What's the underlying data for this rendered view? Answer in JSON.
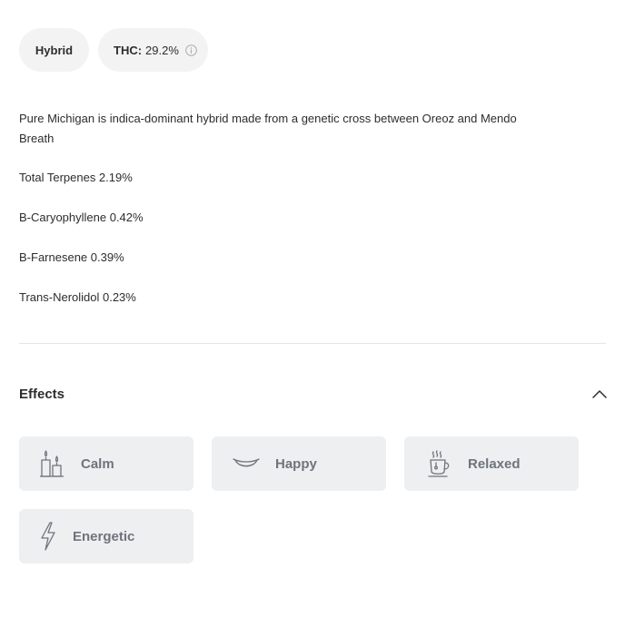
{
  "strain": {
    "type_label": "Hybrid",
    "thc_label": "THC:",
    "thc_value": "29.2%"
  },
  "description": "Pure Michigan is indica-dominant hybrid made from a genetic cross between Oreoz and Mendo Breath",
  "terpenes": [
    "Total Terpenes 2.19%",
    "B-Caryophyllene 0.42%",
    "B-Farnesene 0.39%",
    "Trans-Nerolidol 0.23%"
  ],
  "effects": {
    "title": "Effects",
    "items": [
      {
        "label": "Calm",
        "icon": "candles-icon"
      },
      {
        "label": "Happy",
        "icon": "smile-icon"
      },
      {
        "label": "Relaxed",
        "icon": "coffee-cup-icon"
      },
      {
        "label": "Energetic",
        "icon": "lightning-icon"
      }
    ]
  },
  "colors": {
    "pill_bg": "#f3f3f3",
    "card_bg": "#edeff1",
    "card_text": "#6f747a",
    "text": "#2d2d2d",
    "divider": "#e6e6e6"
  }
}
